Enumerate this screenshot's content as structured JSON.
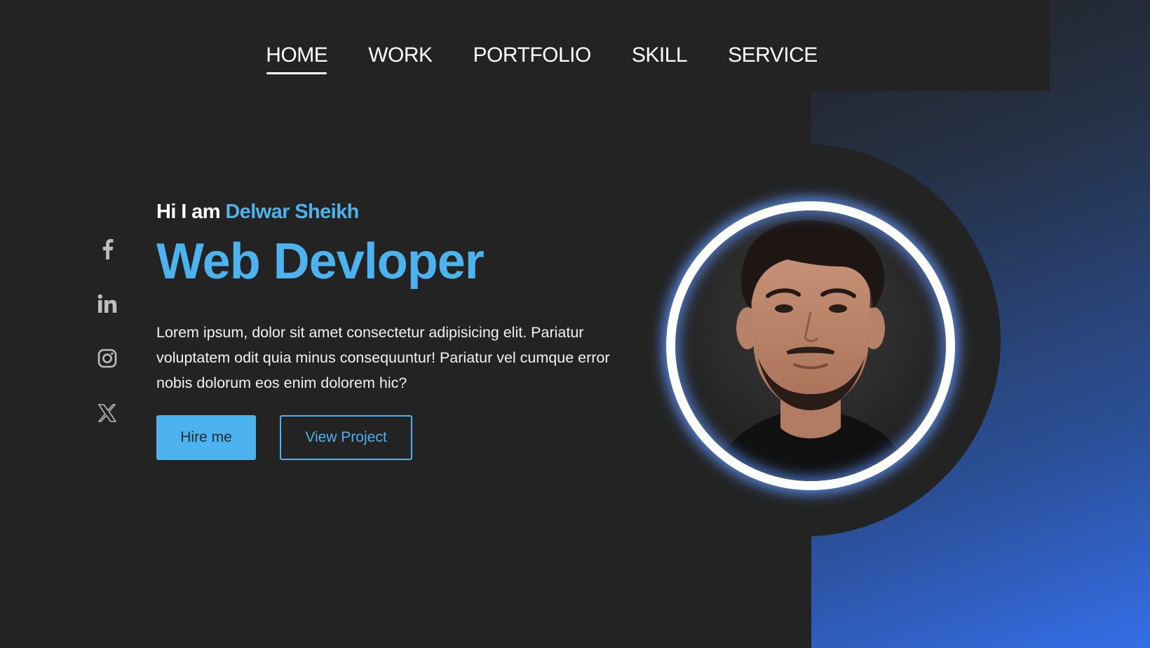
{
  "nav": {
    "items": [
      {
        "label": "HOME",
        "active": true
      },
      {
        "label": "WORK",
        "active": false
      },
      {
        "label": "PORTFOLIO",
        "active": false
      },
      {
        "label": "SKILL",
        "active": false
      },
      {
        "label": "SERVICE",
        "active": false
      }
    ]
  },
  "social": {
    "icons": [
      "facebook-icon",
      "linkedin-icon",
      "instagram-icon",
      "x-twitter-icon"
    ]
  },
  "hero": {
    "greeting_prefix": "Hi I am ",
    "name": "Delwar Sheikh",
    "title": "Web Devloper",
    "description": "Lorem ipsum, dolor sit amet consectetur adipisicing elit. Pariatur voluptatem odit quia minus consequuntur! Pariatur vel cumque error nobis dolorum eos enim dolorem hic?",
    "primary_button": "Hire me",
    "secondary_button": "View Project"
  },
  "colors": {
    "background": "#232323",
    "accent": "#4db3ee",
    "gradient_end": "#356ee8",
    "text": "#ffffff"
  }
}
